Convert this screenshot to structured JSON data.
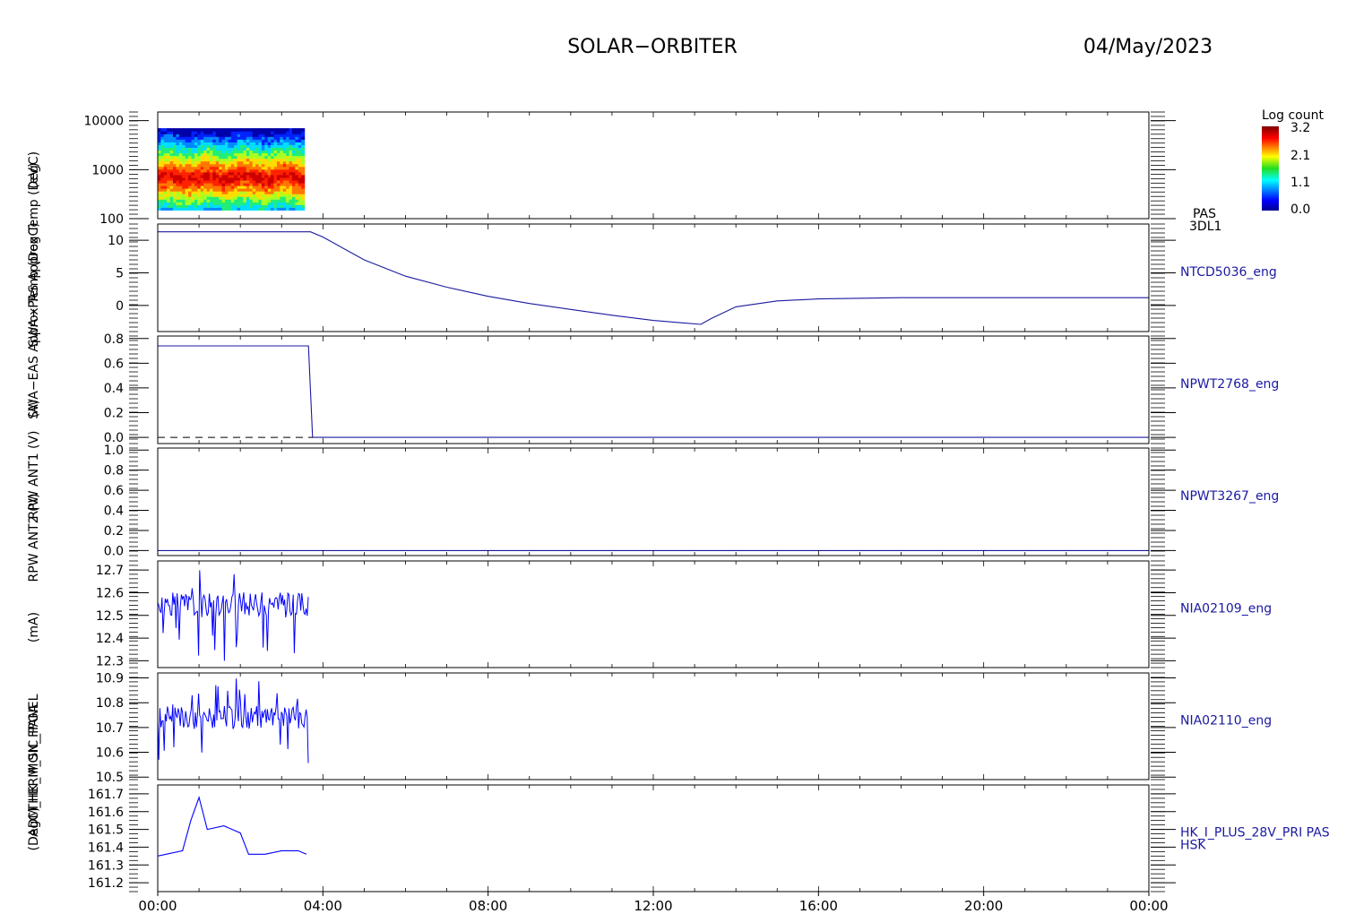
{
  "header": {
    "title": "SOLAR−ORBITER",
    "date": "04/May/2023"
  },
  "colorbar": {
    "title": "Log count",
    "ticks": [
      "3.2",
      "2.1",
      "1.1",
      "0.0"
    ],
    "values": [
      3.2,
      2.1,
      1.1,
      0.0
    ]
  },
  "left_labels": [
    "(eV)",
    "SWA−PAS Approx Temp (DegC)",
    "SWA−EAS Approx Temp (DegC)",
    "(A)",
    "RPW ANT1 (V)",
    "RPW ANT2 (V)",
    "(mA)",
    "ADM_HK_IMON_FPGA",
    "THERM_SIC_PANEL",
    "(DegC)"
  ],
  "panel_labels": [
    {
      "lines": [
        "PAS",
        "3DL1"
      ],
      "color": "#000000"
    },
    {
      "lines": [
        "NTCD5036_eng"
      ],
      "color": "#1a1aa0"
    },
    {
      "lines": [
        "NPWT2768_eng"
      ],
      "color": "#1a1aa0"
    },
    {
      "lines": [
        "NPWT3267_eng"
      ],
      "color": "#1a1aa0"
    },
    {
      "lines": [
        "NIA02109_eng"
      ],
      "color": "#1a1aa0"
    },
    {
      "lines": [
        "NIA02110_eng"
      ],
      "color": "#1a1aa0"
    },
    {
      "lines": [
        "HK_I_PLUS_28V_PRI PAS",
        "HSK"
      ],
      "color": "#1a1aa0"
    }
  ],
  "chart_data": [
    {
      "type": "heatmap",
      "panel": "PAS 3DL1",
      "ylabel": "(eV)",
      "yscale": "log",
      "ylim": [
        100,
        15000
      ],
      "yticks": [
        "10000",
        "1000",
        "100"
      ],
      "ytick_values": [
        10000,
        1000,
        100
      ],
      "x_range_hours": [
        0.0,
        3.55
      ],
      "energy_range_ev": [
        150,
        7000
      ],
      "peak_energy_ev": 700,
      "colorbar_range": [
        0.0,
        3.2
      ]
    },
    {
      "type": "line",
      "panel": "NTCD5036_eng",
      "ylim": [
        -4,
        12.5
      ],
      "yticks": [
        "10",
        "5",
        "0"
      ],
      "ytick_values": [
        10,
        5,
        0
      ],
      "x": [
        0,
        3.7,
        4.0,
        5.0,
        6.0,
        7.0,
        8.0,
        9.0,
        10.0,
        11.0,
        12.0,
        13.15,
        13.4,
        14.0,
        15.0,
        16.0,
        18.0,
        20.0,
        24.0
      ],
      "y": [
        11.3,
        11.3,
        10.5,
        7.0,
        4.5,
        2.8,
        1.4,
        0.3,
        -0.6,
        -1.5,
        -2.3,
        -2.9,
        -2.0,
        -0.2,
        0.7,
        1.0,
        1.2,
        1.2,
        1.2
      ],
      "color": "#1a1aa0"
    },
    {
      "type": "line",
      "panel": "NPWT2768_eng",
      "ylim": [
        -0.05,
        0.82
      ],
      "yticks": [
        "0.8",
        "0.6",
        "0.4",
        "0.2",
        "0.0"
      ],
      "ytick_values": [
        0.8,
        0.6,
        0.4,
        0.2,
        0.0
      ],
      "x": [
        0,
        3.65,
        3.75,
        24.0
      ],
      "y": [
        0.74,
        0.74,
        0.0,
        0.0
      ],
      "reference_line": {
        "value": 0.0,
        "x_range": [
          0,
          3.75
        ],
        "style": "dashed"
      },
      "color": "#1a1aa0"
    },
    {
      "type": "line",
      "panel": "NPWT3267_eng",
      "ylim": [
        -0.05,
        1.02
      ],
      "yticks": [
        "1.0",
        "0.8",
        "0.6",
        "0.4",
        "0.2",
        "0.0"
      ],
      "ytick_values": [
        1.0,
        0.8,
        0.6,
        0.4,
        0.2,
        0.0
      ],
      "x": [
        0,
        24.0
      ],
      "y": [
        0.0,
        0.0
      ],
      "color": "#1a1aa0"
    },
    {
      "type": "line",
      "panel": "NIA02109_eng",
      "ylim": [
        12.27,
        12.74
      ],
      "yticks": [
        "12.7",
        "12.6",
        "12.5",
        "12.4",
        "12.3"
      ],
      "ytick_values": [
        12.7,
        12.6,
        12.5,
        12.4,
        12.3
      ],
      "x_range_hours": [
        0.0,
        3.65
      ],
      "mean": 12.55,
      "low": 12.3,
      "high": 12.72,
      "color": "#0000ff"
    },
    {
      "type": "line",
      "panel": "NIA02110_eng",
      "ylim": [
        10.49,
        10.92
      ],
      "yticks": [
        "10.9",
        "10.8",
        "10.7",
        "10.6",
        "10.5"
      ],
      "ytick_values": [
        10.9,
        10.8,
        10.7,
        10.6,
        10.5
      ],
      "x_range_hours": [
        0.0,
        3.65
      ],
      "mean": 10.74,
      "low": 10.53,
      "high": 10.9,
      "color": "#0000ff"
    },
    {
      "type": "line",
      "panel": "HK_I_PLUS_28V_PRI PAS HSK",
      "ylim": [
        161.15,
        161.75
      ],
      "yticks": [
        "161.7",
        "161.6",
        "161.5",
        "161.4",
        "161.3",
        "161.2"
      ],
      "ytick_values": [
        161.7,
        161.6,
        161.5,
        161.4,
        161.3,
        161.2
      ],
      "x": [
        0,
        0.6,
        0.8,
        1.0,
        1.2,
        1.6,
        2.0,
        2.2,
        2.6,
        3.0,
        3.4,
        3.6
      ],
      "y": [
        161.35,
        161.38,
        161.55,
        161.68,
        161.5,
        161.52,
        161.48,
        161.36,
        161.36,
        161.38,
        161.38,
        161.36
      ],
      "color": "#0000ff"
    }
  ],
  "x_axis": {
    "ticks": [
      "00:00",
      "04:00",
      "08:00",
      "12:00",
      "16:00",
      "20:00",
      "00:00"
    ],
    "tick_hours": [
      0,
      4,
      8,
      12,
      16,
      20,
      24
    ]
  }
}
